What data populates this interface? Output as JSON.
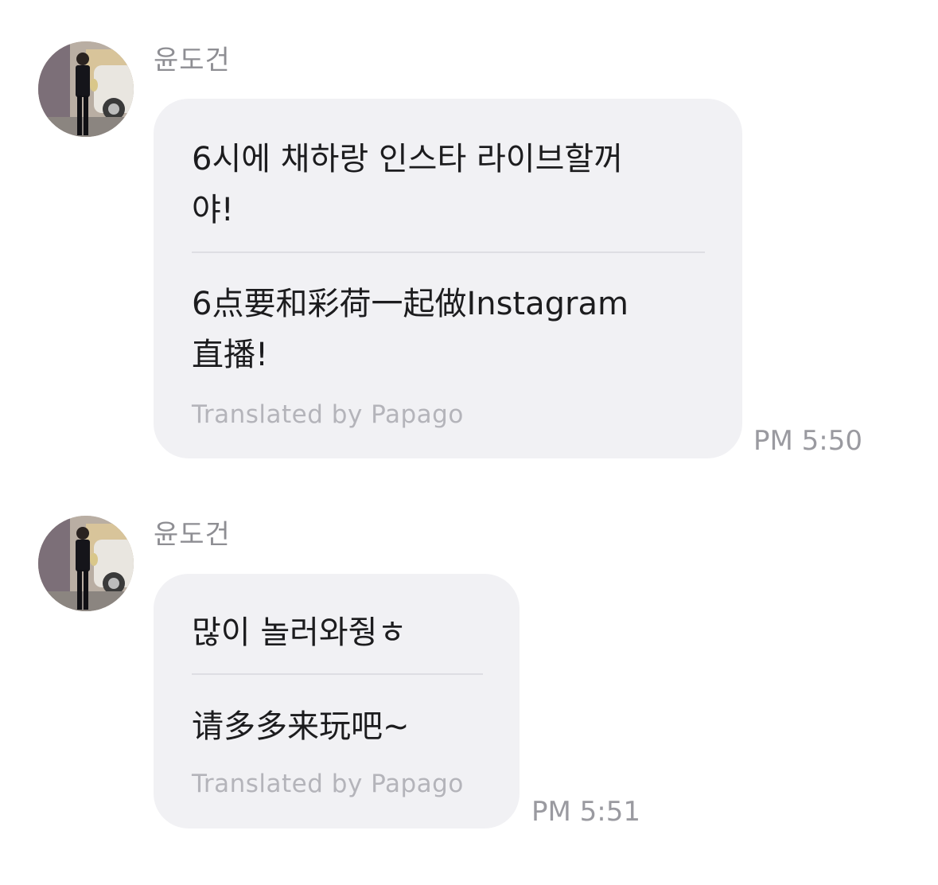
{
  "messages": [
    {
      "sender": "윤도건",
      "original": "6시에 채하랑 인스타 라이브할꺼\n야!",
      "translation": "6点要和彩荷一起做Instagram\n直播!",
      "translated_by": "Translated by Papago",
      "time": "PM 5:50"
    },
    {
      "sender": "윤도건",
      "original": "많이 놀러와줭ㅎ",
      "translation": "请多多来玩吧~",
      "translated_by": "Translated by Papago",
      "time": "PM 5:51"
    }
  ]
}
